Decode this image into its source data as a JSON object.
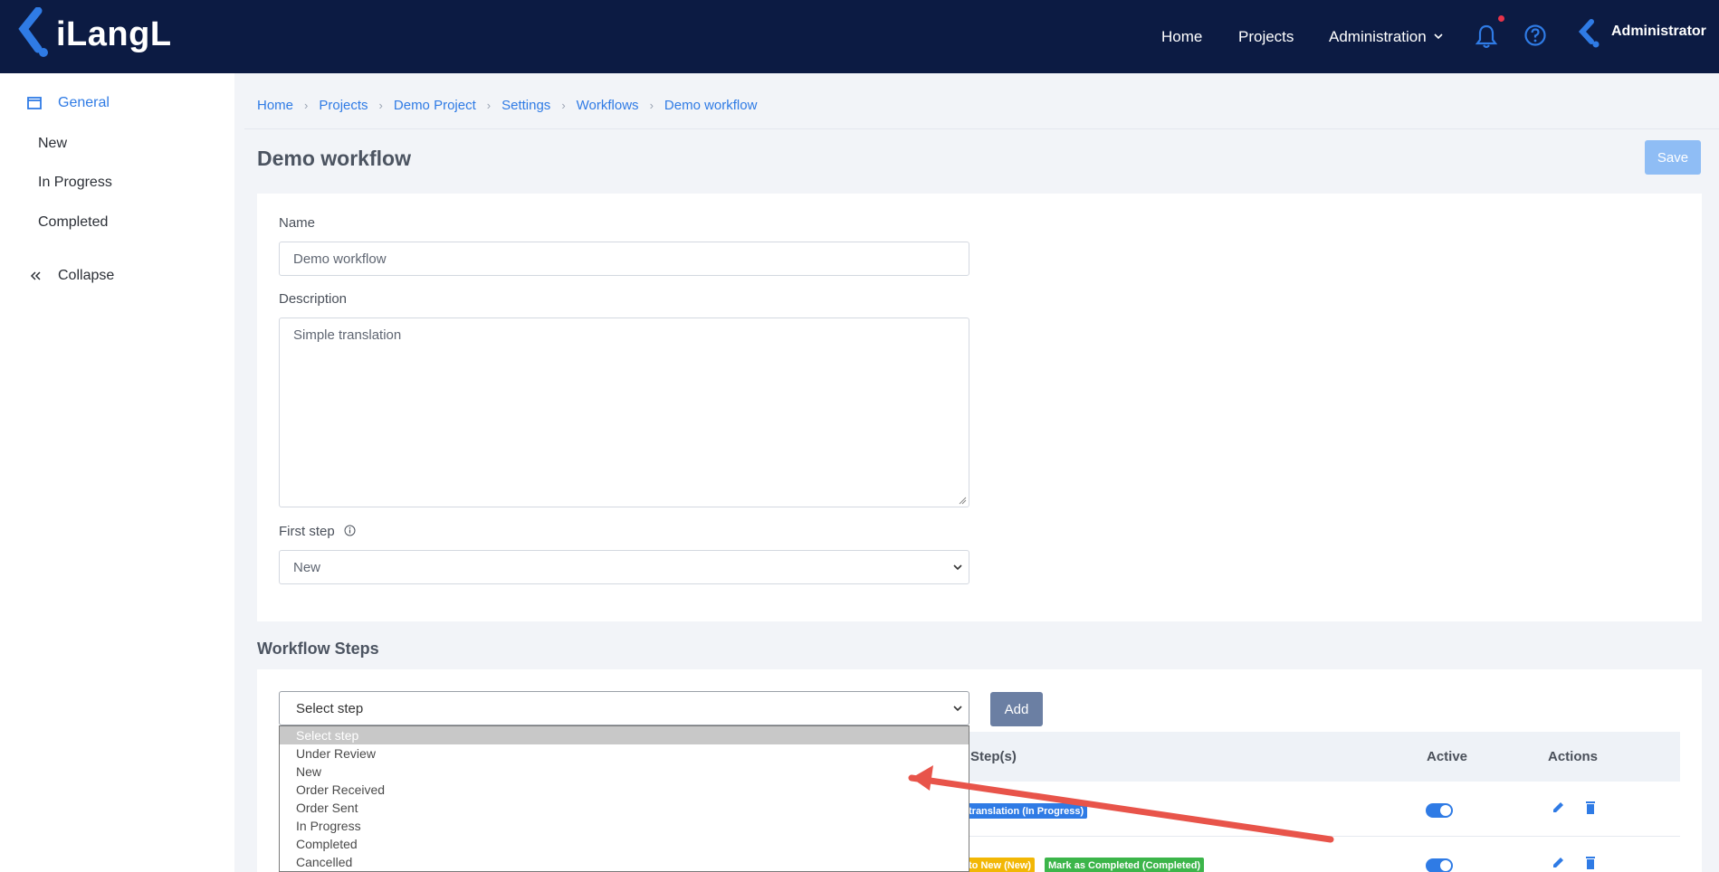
{
  "brand": {
    "name": "iLangL"
  },
  "topnav": {
    "home": "Home",
    "projects": "Projects",
    "administration": "Administration",
    "user": "Administrator"
  },
  "sidebar": {
    "items": [
      {
        "label": "General"
      },
      {
        "label": "New"
      },
      {
        "label": "In Progress"
      },
      {
        "label": "Completed"
      }
    ],
    "collapse": "Collapse"
  },
  "breadcrumb": [
    "Home",
    "Projects",
    "Demo Project",
    "Settings",
    "Workflows",
    "Demo workflow"
  ],
  "page": {
    "title": "Demo workflow",
    "save": "Save"
  },
  "form": {
    "name_label": "Name",
    "name_value": "Demo workflow",
    "description_label": "Description",
    "description_value": "Simple translation",
    "first_step_label": "First step",
    "first_step_value": "New"
  },
  "steps": {
    "title": "Workflow Steps",
    "select_value": "Select step",
    "add": "Add",
    "columns": {
      "next_steps": "Step(s)",
      "active": "Active",
      "actions": "Actions"
    },
    "rows": [
      {
        "badges": [
          "translation (In Progress)"
        ],
        "active": true
      },
      {
        "badges": [
          "to New (New)",
          "Mark as Completed (Completed)"
        ],
        "active": true
      }
    ],
    "options": [
      "Select step",
      "Under Review",
      "New",
      "Order Received",
      "Order Sent",
      "In Progress",
      "Completed",
      "Cancelled"
    ]
  },
  "colors": {
    "topbar": "#0c1b43",
    "accent": "#2f7be5",
    "badge_blue": "#2f7be5",
    "badge_yellow": "#f2b705",
    "badge_green": "#3cb54a",
    "arrow": "#e8544a"
  }
}
